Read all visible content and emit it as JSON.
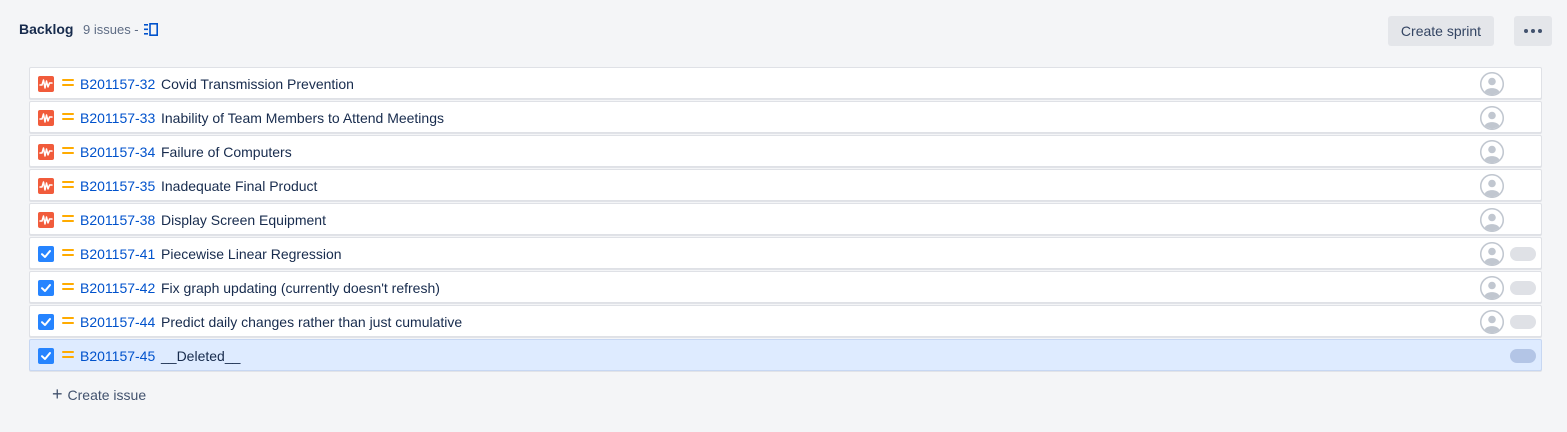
{
  "backlog": {
    "title": "Backlog",
    "count": "9 issues -",
    "create_sprint_label": "Create sprint",
    "create_issue_label": "Create issue"
  },
  "colors": {
    "risk": "#f15b3b",
    "task": "#2684ff",
    "priority": "#ffab00",
    "link": "#0052cc",
    "selected_row": "#deebff"
  },
  "issues": [
    {
      "type_icon": "risk-icon",
      "priority_icon": "medium-priority-icon",
      "key": "B201157-32",
      "summary": "Covid Transmission Prevention",
      "assignee": "unassigned-avatar"
    },
    {
      "type_icon": "risk-icon",
      "priority_icon": "medium-priority-icon",
      "key": "B201157-33",
      "summary": "Inability of Team Members to Attend Meetings",
      "assignee": "unassigned-avatar"
    },
    {
      "type_icon": "risk-icon",
      "priority_icon": "medium-priority-icon",
      "key": "B201157-34",
      "summary": "Failure of Computers",
      "assignee": "unassigned-avatar"
    },
    {
      "type_icon": "risk-icon",
      "priority_icon": "medium-priority-icon",
      "key": "B201157-35",
      "summary": "Inadequate Final Product",
      "assignee": "unassigned-avatar"
    },
    {
      "type_icon": "risk-icon",
      "priority_icon": "medium-priority-icon",
      "key": "B201157-38",
      "summary": "Display Screen Equipment",
      "assignee": "unassigned-avatar"
    },
    {
      "type_icon": "task-icon",
      "priority_icon": "medium-priority-icon",
      "key": "B201157-41",
      "summary": "Piecewise Linear Regression",
      "assignee": "unassigned-avatar"
    },
    {
      "type_icon": "task-icon",
      "priority_icon": "medium-priority-icon",
      "key": "B201157-42",
      "summary": "Fix graph updating (currently doesn't refresh)",
      "assignee": "unassigned-avatar"
    },
    {
      "type_icon": "task-icon",
      "priority_icon": "medium-priority-icon",
      "key": "B201157-44",
      "summary": "Predict daily changes rather than just cumulative",
      "assignee": "unassigned-avatar"
    },
    {
      "type_icon": "task-icon",
      "priority_icon": "medium-priority-icon",
      "key": "B201157-45",
      "summary": "__Deleted__",
      "assignee": ""
    }
  ]
}
